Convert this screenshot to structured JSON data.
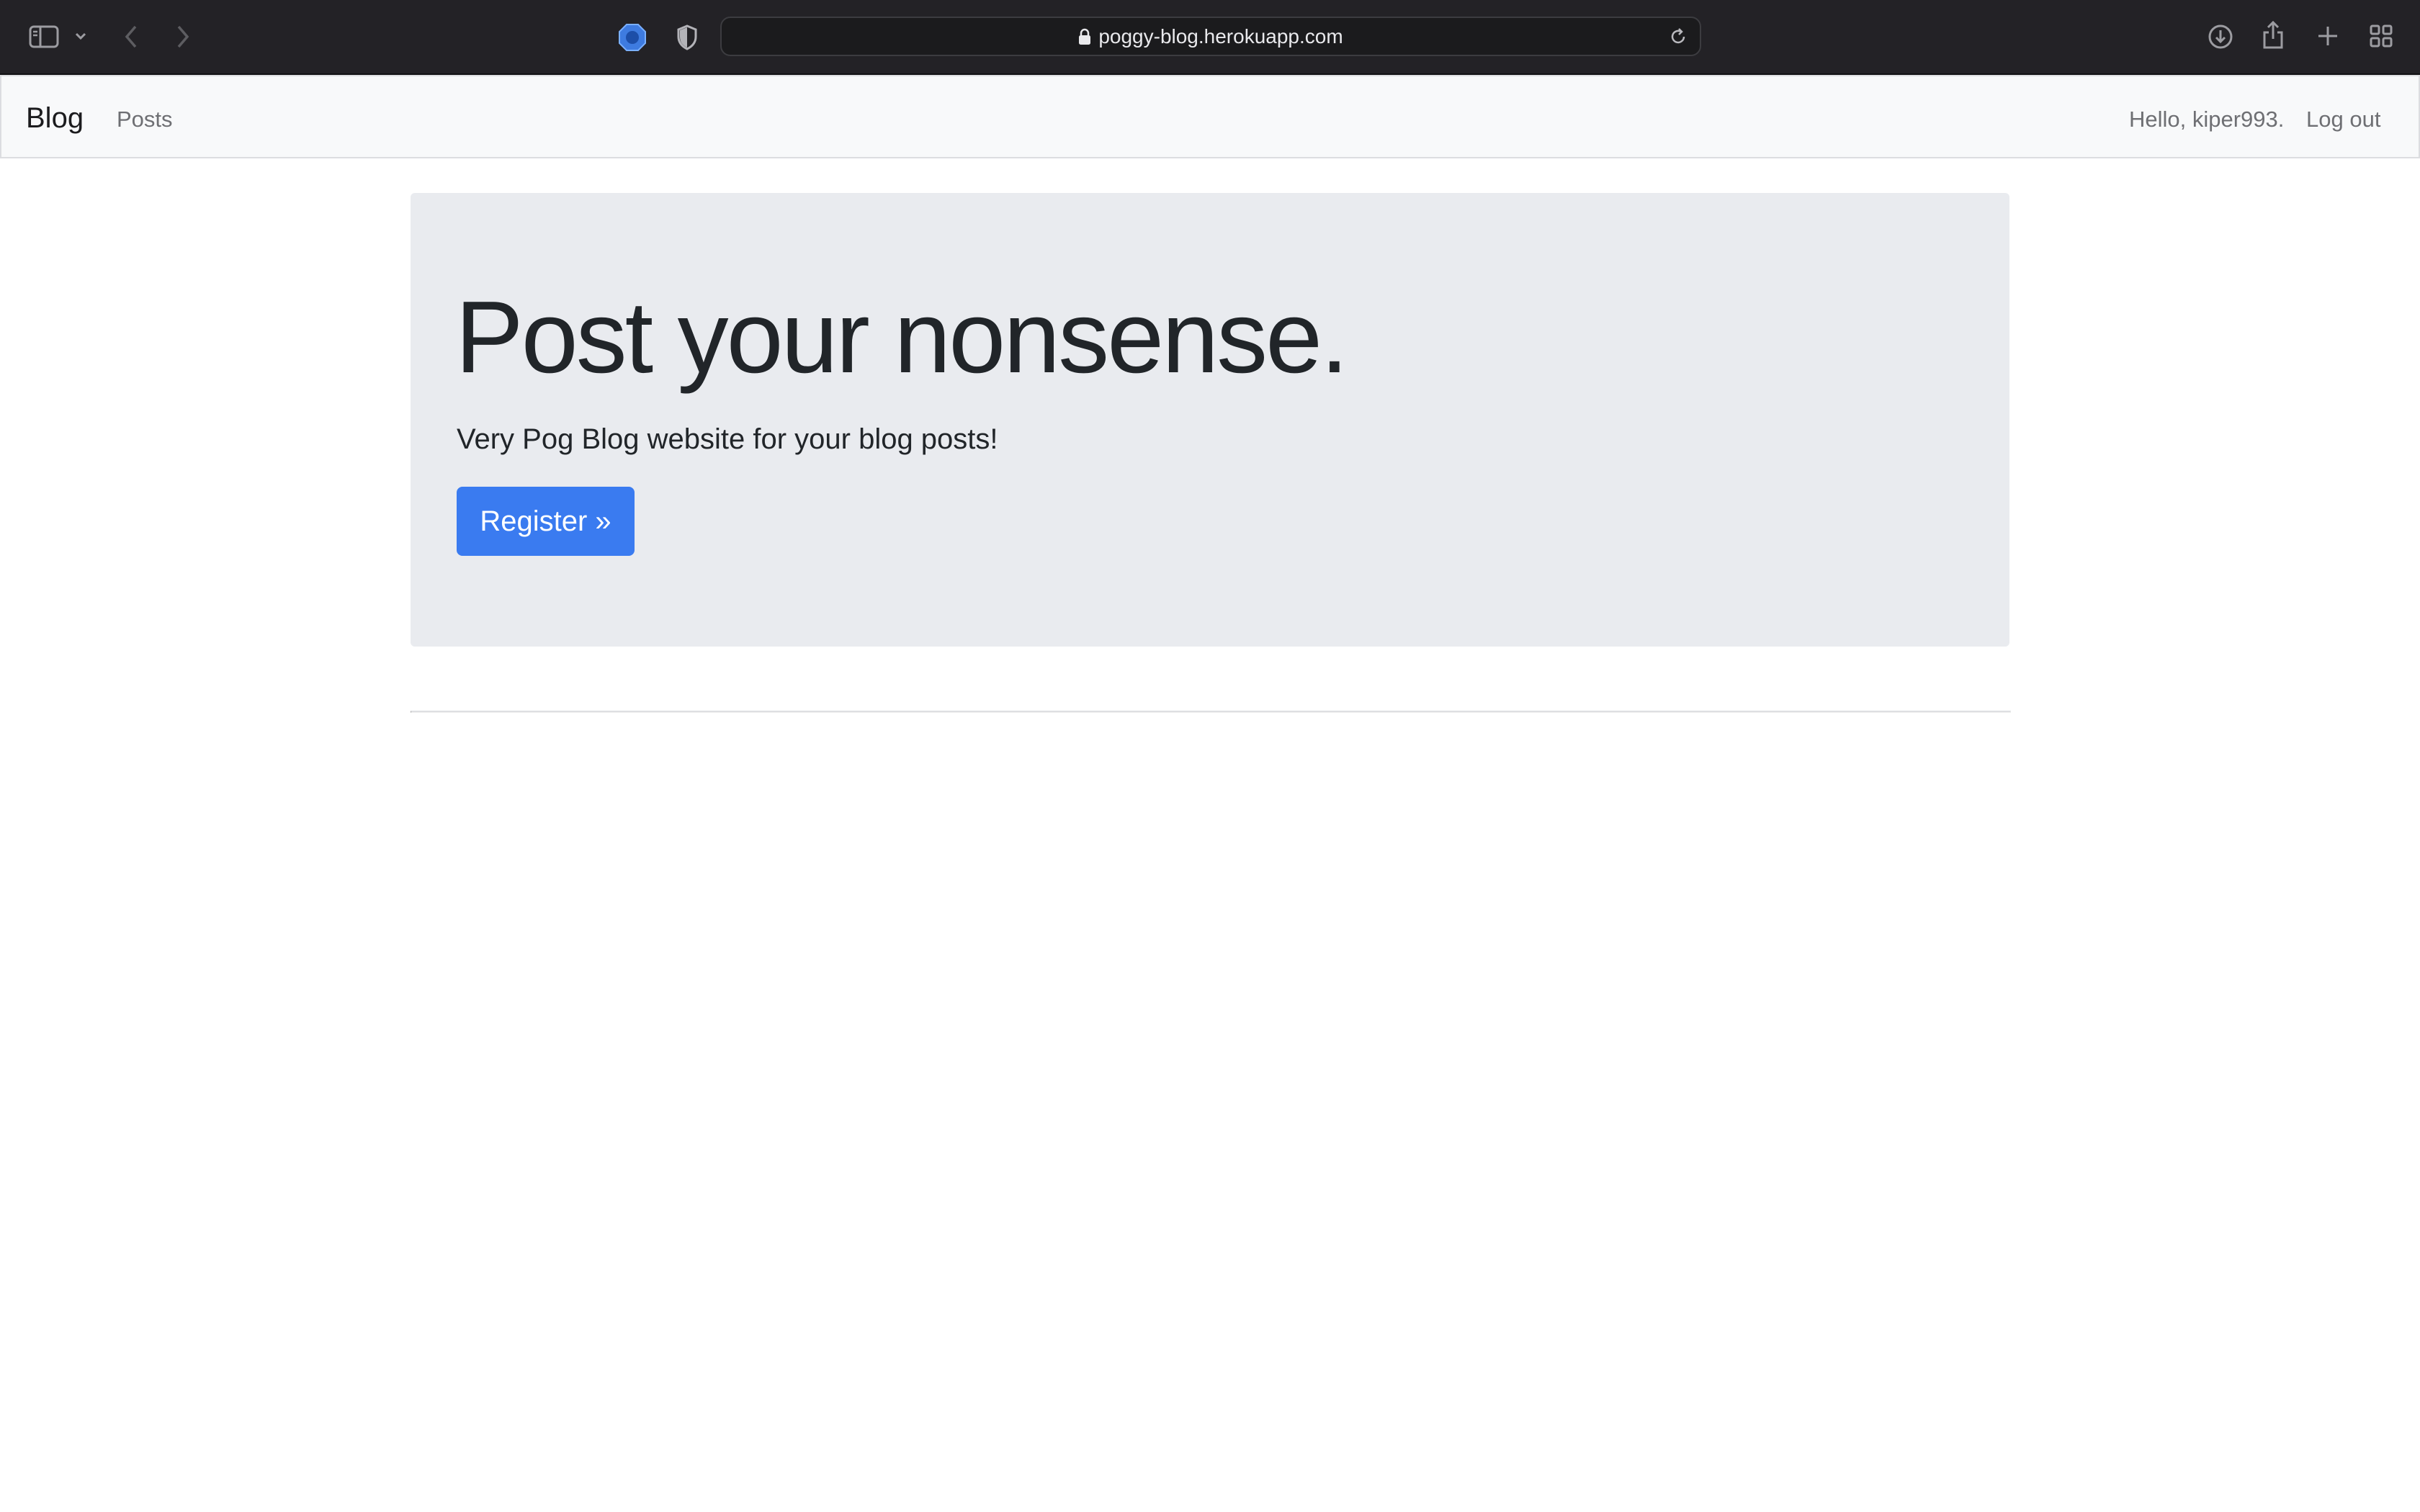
{
  "browser": {
    "url": "poggy-blog.herokuapp.com",
    "icons": {
      "sidebar": "sidebar-icon",
      "chevron": "chevron-down-icon",
      "back": "back-arrow-icon",
      "forward": "forward-arrow-icon",
      "extension_badge": "extension-badge-icon",
      "privacy": "privacy-shield-icon",
      "lock": "lock-icon",
      "reload": "reload-icon",
      "downloads": "download-icon",
      "share": "share-icon",
      "new_tab": "plus-icon",
      "tab_overview": "tab-overview-icon"
    }
  },
  "navbar": {
    "brand": "Blog",
    "posts_link": "Posts",
    "greeting": "Hello, kiper993.",
    "logout": "Log out"
  },
  "hero": {
    "heading": "Post your nonsense.",
    "lead": "Very Pog Blog website for your blog posts!",
    "button_label": "Register »"
  },
  "colors": {
    "toolbar_bg": "#232226",
    "navbar_bg": "#f8f9fa",
    "jumbotron_bg": "#e9ebef",
    "primary": "#3a7bf0",
    "text_dark": "#212529",
    "text_muted": "#6e6f73"
  }
}
